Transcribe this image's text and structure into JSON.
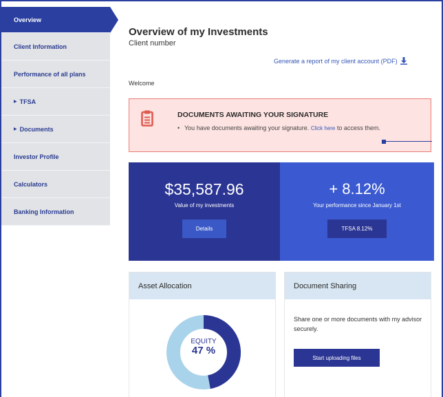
{
  "sidebar": {
    "items": [
      {
        "label": "Overview",
        "active": true
      },
      {
        "label": "Client Information"
      },
      {
        "label": "Performance of all plans"
      },
      {
        "label": "TFSA",
        "expandable": true
      },
      {
        "label": "Documents",
        "expandable": true
      },
      {
        "label": "Investor Profile"
      },
      {
        "label": "Calculators"
      },
      {
        "label": "Banking Information"
      }
    ]
  },
  "header": {
    "title": "Overview of my Investments",
    "subtitle": "Client number",
    "report_link": "Generate a report of my client account (PDF)",
    "report_icon": "download-icon"
  },
  "welcome": "Welcome",
  "alert": {
    "title": "DOCUMENTS AWAITING YOUR SIGNATURE",
    "text_before": "You have documents awaiting your signature.",
    "link": "Click here",
    "text_after": "to access them.",
    "icon": "clipboard-icon",
    "accent_color": "#e05a4e"
  },
  "stats": {
    "investments": {
      "value": "$35,587.96",
      "label": "Value of my investments",
      "button": "Details"
    },
    "performance": {
      "value": "+ 8.12%",
      "label": "Your performance since January 1st",
      "button": "TFSA 8.12%"
    }
  },
  "allocation": {
    "title": "Asset Allocation",
    "center_label": "EQUITY",
    "center_value": "47 %",
    "equity_percent": 47,
    "equity_color": "#2b3593",
    "other_color": "#a9d3ea"
  },
  "sharing": {
    "title": "Document Sharing",
    "text": "Share one or more documents with my advisor securely.",
    "button": "Start uploading files"
  }
}
